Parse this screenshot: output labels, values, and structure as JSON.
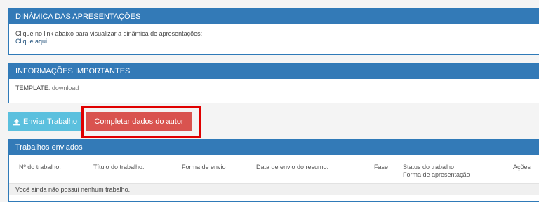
{
  "dinamica": {
    "title": "DINÂMICA DAS APRESENTAÇÕES",
    "text": "Clique no link abaixo para visualizar a dinâmica de apresentações:",
    "link": "Clique aqui"
  },
  "informacoes": {
    "title": "INFORMAÇÕES IMPORTANTES",
    "template_label": "TEMPLATE:",
    "template_link": "download"
  },
  "actions": {
    "enviar_icon": "upload-icon",
    "enviar_label": "Enviar Trabalho",
    "completar_label": "Completar dados do autor"
  },
  "trabalhos": {
    "title": "Trabalhos enviados",
    "columns": {
      "numero": "Nº do trabalho:",
      "titulo": "Título do trabalho:",
      "forma_envio": "Forma de envio",
      "data_envio": "Data de envio do resumo:",
      "fase": "Fase",
      "status": "Status do trabalho",
      "forma_apresentacao": "Forma de apresentação",
      "acoes": "Ações"
    },
    "empty_message": "Você ainda não possui nenhum trabalho."
  },
  "colors": {
    "panel_header": "#337ab7",
    "info_button": "#5bc0de",
    "danger_button": "#d9534f",
    "highlight": "#e00000"
  }
}
